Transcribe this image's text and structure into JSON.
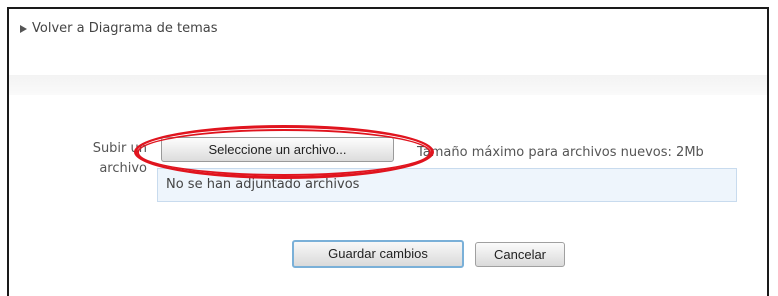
{
  "nav": {
    "back_link": "Volver a Diagrama de temas",
    "back_icon": "triangle-right-icon"
  },
  "upload": {
    "label": "Subir un archivo",
    "select_button": "Seleccione un archivo...",
    "max_size": "Tamaño máximo para archivos nuevos: 2Mb",
    "empty_message": "No se han adjuntado archivos"
  },
  "actions": {
    "save_label": "Guardar cambios",
    "cancel_label": "Cancelar"
  },
  "annotation": {
    "highlight_color": "#e0141e"
  },
  "colors": {
    "file_box_bg": "#eef5fc",
    "save_border": "#7ab0d8"
  }
}
